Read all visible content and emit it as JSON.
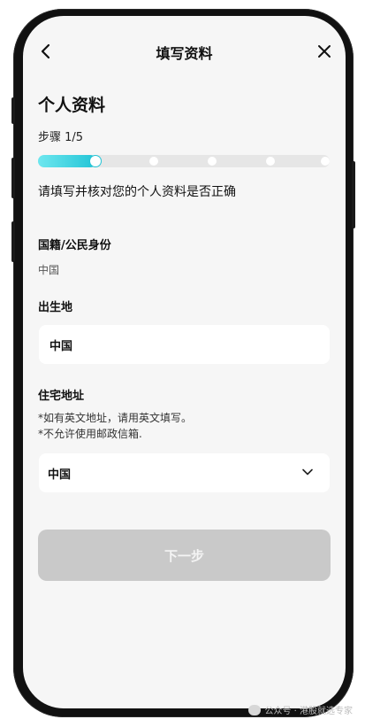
{
  "header": {
    "title": "填写资料"
  },
  "page": {
    "section_title": "个人资料",
    "step_label": "步骤 1/5",
    "progress_fraction": 0.2,
    "instruction": "请填写并核对您的个人资料是否正确"
  },
  "fields": {
    "nationality": {
      "label": "国籍/公民身份",
      "value": "中国"
    },
    "birthplace": {
      "label": "出生地",
      "value": "中国"
    },
    "address": {
      "label": "住宅地址",
      "note_1": "*如有英文地址，请用英文填写。",
      "note_2": "*不允许使用邮政信箱.",
      "selected": "中国"
    }
  },
  "actions": {
    "next_label": "下一步"
  },
  "watermark": {
    "text": "公众号 · 港股就选专家"
  },
  "colors": {
    "accent": "#22c4d6",
    "disabled_button": "#c9c9c9",
    "screen_bg": "#f6f6f6"
  },
  "icons": [
    "back-arrow-icon",
    "close-icon",
    "chevron-down-icon",
    "wechat-icon"
  ]
}
